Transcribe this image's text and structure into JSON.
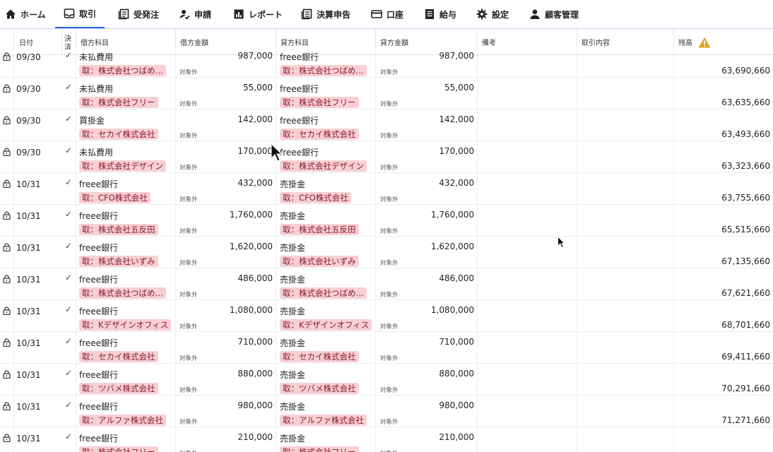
{
  "nav": {
    "items": [
      {
        "label": "ホーム",
        "icon": "home-icon"
      },
      {
        "label": "取引",
        "icon": "inbox-icon"
      },
      {
        "label": "受発注",
        "icon": "orders-icon"
      },
      {
        "label": "申請",
        "icon": "person-check-icon"
      },
      {
        "label": "レポート",
        "icon": "report-icon"
      },
      {
        "label": "決算申告",
        "icon": "ledger-icon"
      },
      {
        "label": "口座",
        "icon": "card-icon"
      },
      {
        "label": "給与",
        "icon": "payroll-icon"
      },
      {
        "label": "設定",
        "icon": "gear-icon"
      },
      {
        "label": "顧客管理",
        "icon": "person-icon"
      }
    ],
    "active": "取引",
    "accent_color": "#2864f0"
  },
  "table": {
    "headers": {
      "date": "日付",
      "settled": "決済",
      "debit_account": "借方科目",
      "debit_amount": "借方金額",
      "credit_account": "貸方科目",
      "credit_amount": "貸方金額",
      "memo": "備考",
      "description": "取引内容",
      "balance": "残高"
    },
    "tax_label": "対象外",
    "partner_color": "#f7cfd5",
    "rows": [
      {
        "date": "09/30",
        "check": "✓",
        "debit_account": "未払費用",
        "debit_partner": "取：株式会社つばめ…",
        "debit_amount": "987,000",
        "credit_account": "freee銀行",
        "credit_partner": "取：株式会社つばめ…",
        "credit_amount": "987,000",
        "balance": "63,690,660"
      },
      {
        "date": "09/30",
        "check": "✓",
        "debit_account": "未払費用",
        "debit_partner": "取：株式会社フリー",
        "debit_amount": "55,000",
        "credit_account": "freee銀行",
        "credit_partner": "取：株式会社フリー",
        "credit_amount": "55,000",
        "balance": "63,635,660"
      },
      {
        "date": "09/30",
        "check": "✓",
        "debit_account": "買掛金",
        "debit_partner": "取：セカイ株式会社",
        "debit_amount": "142,000",
        "credit_account": "freee銀行",
        "credit_partner": "取：セカイ株式会社",
        "credit_amount": "142,000",
        "balance": "63,493,660"
      },
      {
        "date": "09/30",
        "check": "✓",
        "debit_account": "未払費用",
        "debit_partner": "取：株式会社デザイン",
        "debit_amount": "170,000",
        "credit_account": "freee銀行",
        "credit_partner": "取：株式会社デザイン",
        "credit_amount": "170,000",
        "balance": "63,323,660"
      },
      {
        "date": "10/31",
        "check": "✓",
        "debit_account": "freee銀行",
        "debit_partner": "取：CFO株式会社",
        "debit_amount": "432,000",
        "credit_account": "売掛金",
        "credit_partner": "取：CFO株式会社",
        "credit_amount": "432,000",
        "balance": "63,755,660"
      },
      {
        "date": "10/31",
        "check": "✓",
        "debit_account": "freee銀行",
        "debit_partner": "取：株式会社五反田",
        "debit_amount": "1,760,000",
        "credit_account": "売掛金",
        "credit_partner": "取：株式会社五反田",
        "credit_amount": "1,760,000",
        "balance": "65,515,660"
      },
      {
        "date": "10/31",
        "check": "✓",
        "debit_account": "freee銀行",
        "debit_partner": "取：株式会社いずみ",
        "debit_amount": "1,620,000",
        "credit_account": "売掛金",
        "credit_partner": "取：株式会社いずみ",
        "credit_amount": "1,620,000",
        "balance": "67,135,660"
      },
      {
        "date": "10/31",
        "check": "✓",
        "debit_account": "freee銀行",
        "debit_partner": "取：株式会社つばめ…",
        "debit_amount": "486,000",
        "credit_account": "売掛金",
        "credit_partner": "取：株式会社つばめ…",
        "credit_amount": "486,000",
        "balance": "67,621,660"
      },
      {
        "date": "10/31",
        "check": "✓",
        "debit_account": "freee銀行",
        "debit_partner": "取：Kデザインオフィス",
        "debit_amount": "1,080,000",
        "credit_account": "売掛金",
        "credit_partner": "取：Kデザインオフィス",
        "credit_amount": "1,080,000",
        "balance": "68,701,660"
      },
      {
        "date": "10/31",
        "check": "✓",
        "debit_account": "freee銀行",
        "debit_partner": "取：セカイ株式会社",
        "debit_amount": "710,000",
        "credit_account": "売掛金",
        "credit_partner": "取：セカイ株式会社",
        "credit_amount": "710,000",
        "balance": "69,411,660"
      },
      {
        "date": "10/31",
        "check": "✓",
        "debit_account": "freee銀行",
        "debit_partner": "取：ツバメ株式会社",
        "debit_amount": "880,000",
        "credit_account": "売掛金",
        "credit_partner": "取：ツバメ株式会社",
        "credit_amount": "880,000",
        "balance": "70,291,660"
      },
      {
        "date": "10/31",
        "check": "✓",
        "debit_account": "freee銀行",
        "debit_partner": "取：アルファ株式会社",
        "debit_amount": "980,000",
        "credit_account": "売掛金",
        "credit_partner": "取：アルファ株式会社",
        "credit_amount": "980,000",
        "balance": "71,271,660"
      },
      {
        "date": "10/31",
        "check": "✓",
        "debit_account": "freee銀行",
        "debit_partner": "取：株式会社フリー",
        "debit_amount": "210,000",
        "credit_account": "売掛金",
        "credit_partner": "取：株式会社フリー",
        "credit_amount": "210,000",
        "balance": ""
      }
    ]
  }
}
